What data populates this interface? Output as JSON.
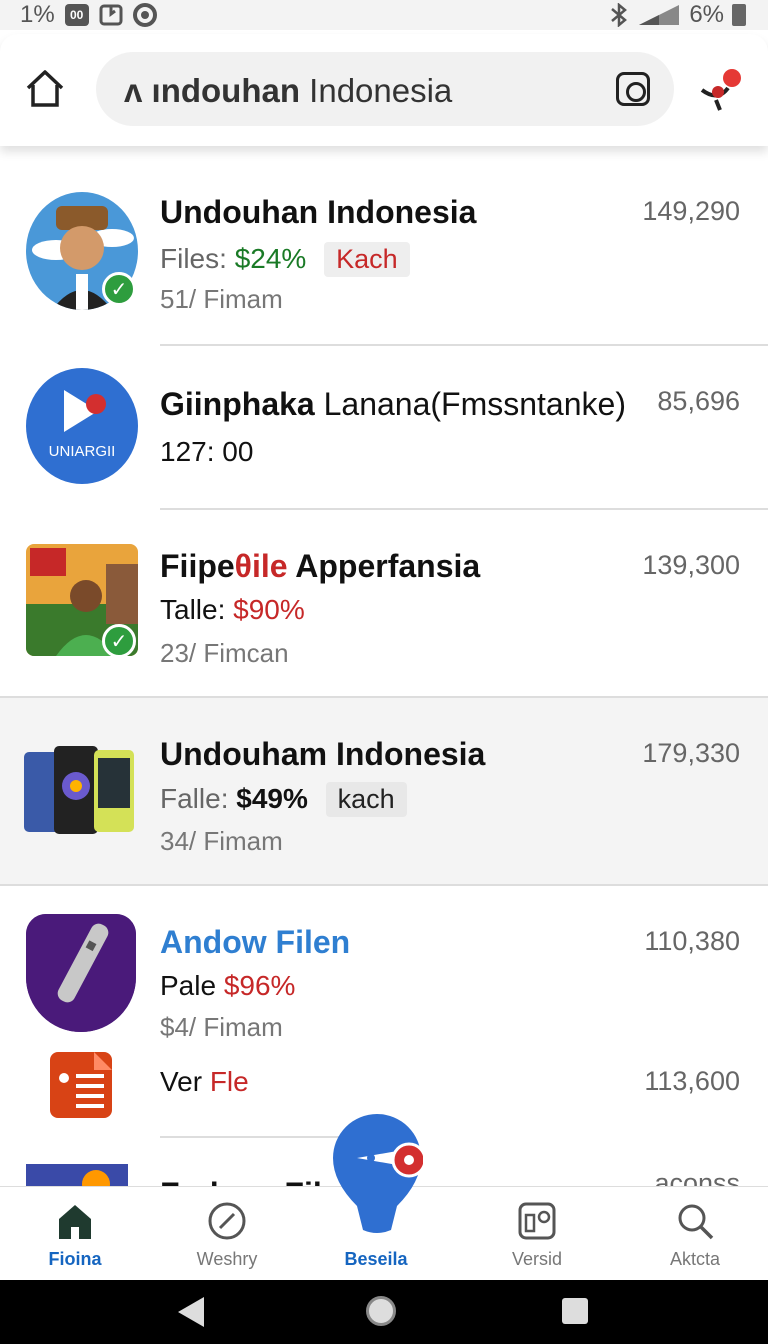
{
  "status_bar": {
    "left_text": "1%",
    "box_text": "00",
    "battery_text": "6%"
  },
  "header": {
    "search_query_bold": "ʌ ındouhan",
    "search_query_rest": " Indonesia"
  },
  "items": [
    {
      "title": "Undouhan Indonesia",
      "label": "Files:",
      "value": "$24%",
      "chip": "Kach",
      "meta": "51/ Fimam",
      "count": "149,290"
    },
    {
      "title_part1": "Giinphaka",
      "title_part2": " Lanana(Fmssntanke)",
      "time": "127: 00",
      "avatar_text": "UNIARGII",
      "count": "85,696"
    },
    {
      "title_part1": "Fiipe",
      "title_part2": "θile",
      "title_part3": " Apperfansia",
      "label": "Talle:",
      "value": "$90%",
      "meta": "23/ Fimcan",
      "count": "139,300"
    },
    {
      "title": "Undouham Indonesia",
      "label": "Falle:",
      "value": "$49%",
      "chip": "kach",
      "meta": "34/ Fimam",
      "count": "179,330"
    },
    {
      "title": "Andow Filen",
      "label": "Pale",
      "value": "$96%",
      "meta": "$4/ Fimam",
      "count": "110,380"
    },
    {
      "label": "Ver",
      "value": "Fle",
      "count": "113,600"
    },
    {
      "title": "Fndnan Filo",
      "count": "aconss"
    }
  ],
  "nav": {
    "home": "Fioina",
    "weshry": "Weshry",
    "center": "Beseila",
    "versid": "Versid",
    "aktcta": "Aktcta"
  },
  "colors": {
    "accent_blue": "#1565c0",
    "fab_blue": "#2f6fd1",
    "red": "#c62828",
    "green": "#1a7a26"
  }
}
